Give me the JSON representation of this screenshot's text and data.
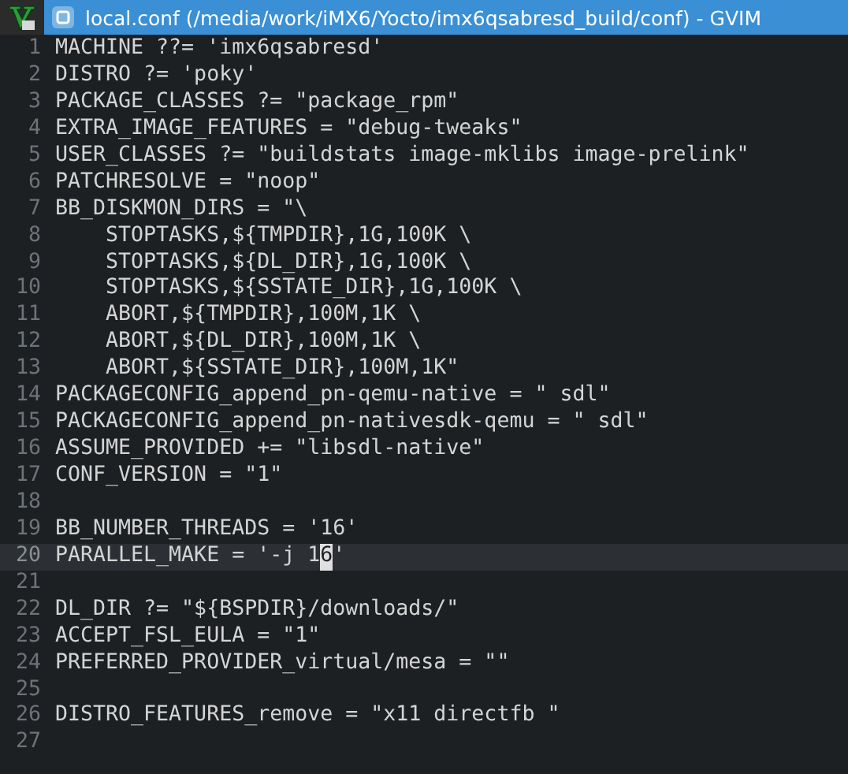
{
  "window": {
    "title": "local.conf (/media/work/iMX6/Yocto/imx6qsabresd_build/conf) - GVIM"
  },
  "lines": [
    {
      "number": "1",
      "text": "MACHINE ??= 'imx6qsabresd'",
      "current": false
    },
    {
      "number": "2",
      "text": "DISTRO ?= 'poky'",
      "current": false
    },
    {
      "number": "3",
      "text": "PACKAGE_CLASSES ?= \"package_rpm\"",
      "current": false
    },
    {
      "number": "4",
      "text": "EXTRA_IMAGE_FEATURES = \"debug-tweaks\"",
      "current": false
    },
    {
      "number": "5",
      "text": "USER_CLASSES ?= \"buildstats image-mklibs image-prelink\"",
      "current": false
    },
    {
      "number": "6",
      "text": "PATCHRESOLVE = \"noop\"",
      "current": false
    },
    {
      "number": "7",
      "text": "BB_DISKMON_DIRS = \"\\",
      "current": false
    },
    {
      "number": "8",
      "text": "    STOPTASKS,${TMPDIR},1G,100K \\",
      "current": false
    },
    {
      "number": "9",
      "text": "    STOPTASKS,${DL_DIR},1G,100K \\",
      "current": false
    },
    {
      "number": "10",
      "text": "    STOPTASKS,${SSTATE_DIR},1G,100K \\",
      "current": false
    },
    {
      "number": "11",
      "text": "    ABORT,${TMPDIR},100M,1K \\",
      "current": false
    },
    {
      "number": "12",
      "text": "    ABORT,${DL_DIR},100M,1K \\",
      "current": false
    },
    {
      "number": "13",
      "text": "    ABORT,${SSTATE_DIR},100M,1K\"",
      "current": false
    },
    {
      "number": "14",
      "text": "PACKAGECONFIG_append_pn-qemu-native = \" sdl\"",
      "current": false
    },
    {
      "number": "15",
      "text": "PACKAGECONFIG_append_pn-nativesdk-qemu = \" sdl\"",
      "current": false
    },
    {
      "number": "16",
      "text": "ASSUME_PROVIDED += \"libsdl-native\"",
      "current": false
    },
    {
      "number": "17",
      "text": "CONF_VERSION = \"1\"",
      "current": false
    },
    {
      "number": "18",
      "current": false
    },
    {
      "number": "19",
      "text": "BB_NUMBER_THREADS = '16'",
      "current": false
    },
    {
      "number": "20",
      "text": "PARALLEL_MAKE = '-j 1",
      "cursor": "6",
      "rest": "'",
      "current": true
    },
    {
      "number": "21",
      "current": false
    },
    {
      "number": "22",
      "text": "DL_DIR ?= \"${BSPDIR}/downloads/\"",
      "current": false
    },
    {
      "number": "23",
      "text": "ACCEPT_FSL_EULA = \"1\"",
      "current": false
    },
    {
      "number": "24",
      "text": "PREFERRED_PROVIDER_virtual/mesa = \"\"",
      "current": false
    },
    {
      "number": "25",
      "current": false
    },
    {
      "number": "26",
      "text": "DISTRO_FEATURES_remove = \"x11 directfb \"",
      "current": false
    },
    {
      "number": "27",
      "current": false
    }
  ]
}
